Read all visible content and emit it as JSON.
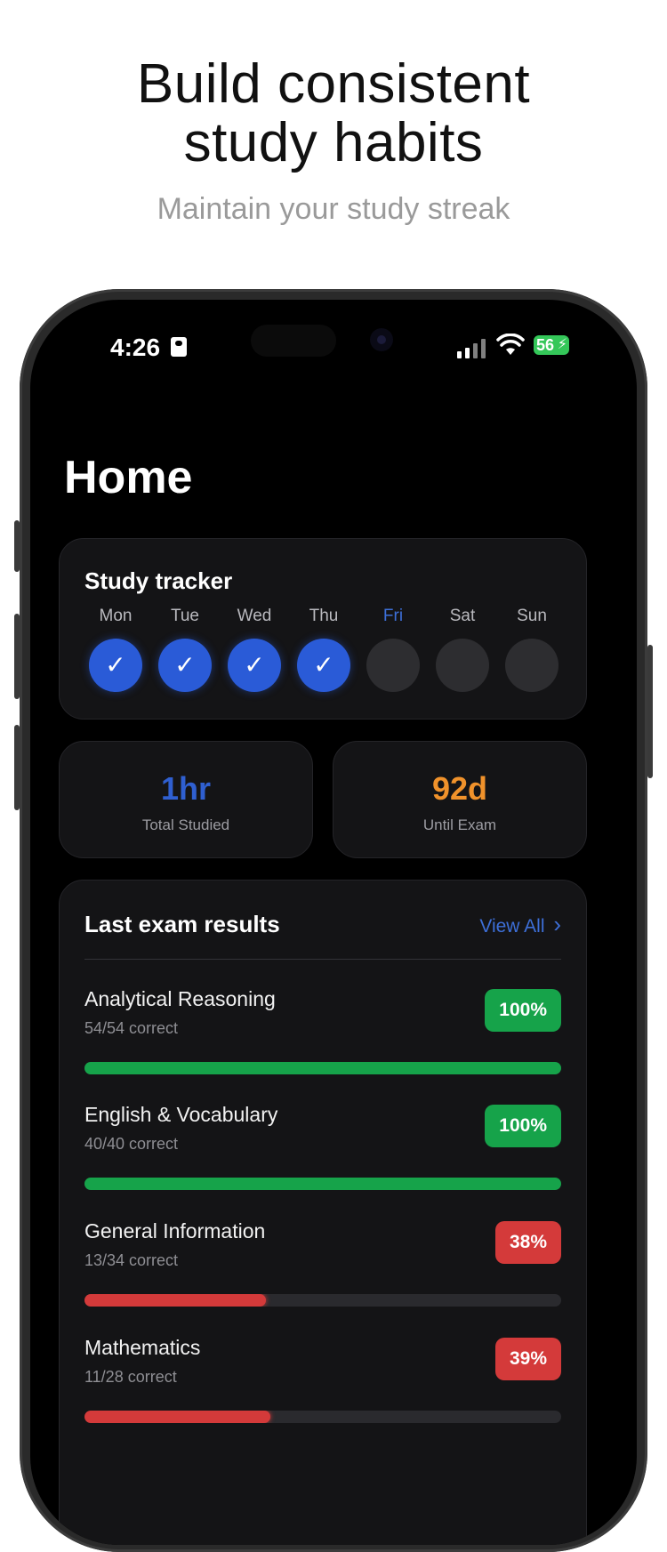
{
  "promo": {
    "title_line1": "Build consistent",
    "title_line2": "study habits",
    "subtitle": "Maintain your study streak"
  },
  "status_bar": {
    "time": "4:26",
    "battery": "56"
  },
  "page": {
    "title": "Home"
  },
  "tracker": {
    "title": "Study tracker",
    "days": [
      {
        "label": "Mon",
        "done": true
      },
      {
        "label": "Tue",
        "done": true
      },
      {
        "label": "Wed",
        "done": true
      },
      {
        "label": "Thu",
        "done": true
      },
      {
        "label": "Fri",
        "done": false,
        "today": true
      },
      {
        "label": "Sat",
        "done": false
      },
      {
        "label": "Sun",
        "done": false
      }
    ],
    "check_glyph": "✓"
  },
  "stats": {
    "studied": {
      "value": "1hr",
      "label": "Total Studied",
      "color": "#2f5fd0"
    },
    "until_exam": {
      "value": "92d",
      "label": "Until Exam",
      "color": "#f0922b"
    }
  },
  "results": {
    "title": "Last exam results",
    "view_all": "View All",
    "chevron": "›",
    "items": [
      {
        "name": "Analytical Reasoning",
        "score": "54/54 correct",
        "percent": "100%",
        "fraction": 1.0,
        "color": "#16a34a"
      },
      {
        "name": "English & Vocabulary",
        "score": "40/40 correct",
        "percent": "100%",
        "fraction": 1.0,
        "color": "#16a34a"
      },
      {
        "name": "General Information",
        "score": "13/34 correct",
        "percent": "38%",
        "fraction": 0.38,
        "color": "#d43a3a"
      },
      {
        "name": "Mathematics",
        "score": "11/28 correct",
        "percent": "39%",
        "fraction": 0.39,
        "color": "#d43a3a"
      }
    ]
  }
}
